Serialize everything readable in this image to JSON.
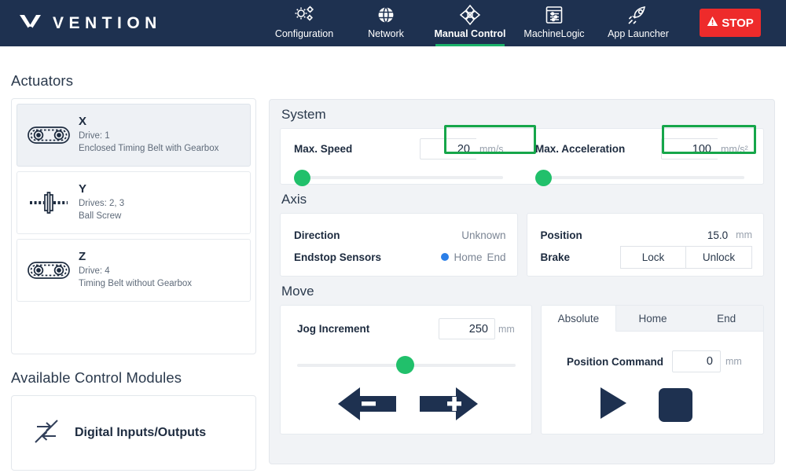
{
  "header": {
    "brand": "VENTION",
    "logo_icon": "vention-chevron-logo",
    "nav": [
      {
        "label": "Configuration",
        "icon": "gears-icon",
        "active": false
      },
      {
        "label": "Network",
        "icon": "globe-icon",
        "active": false
      },
      {
        "label": "Manual Control",
        "icon": "axes-move-icon",
        "active": true
      },
      {
        "label": "MachineLogic",
        "icon": "panel-sliders-icon",
        "active": false
      },
      {
        "label": "App Launcher",
        "icon": "rocket-icon",
        "active": false
      }
    ],
    "stop_button": {
      "label": "STOP",
      "icon": "warning-triangle-icon",
      "color": "#ee2b2b"
    }
  },
  "sidebar": {
    "actuators_title": "Actuators",
    "actuators": [
      {
        "name": "X",
        "drive": "Drive: 1",
        "type": "Enclosed Timing Belt with Gearbox",
        "icon": "timing-belt-icon",
        "selected": true
      },
      {
        "name": "Y",
        "drive": "Drives: 2, 3",
        "type": "Ball Screw",
        "icon": "ball-screw-icon",
        "selected": false
      },
      {
        "name": "Z",
        "drive": "Drive: 4",
        "type": "Timing Belt without Gearbox",
        "icon": "timing-belt-icon",
        "selected": false
      }
    ],
    "modules_title": "Available Control Modules",
    "modules": [
      {
        "label": "Digital Inputs/Outputs",
        "icon": "digital-io-icon"
      }
    ]
  },
  "system": {
    "title": "System",
    "max_speed": {
      "label": "Max. Speed",
      "value": "20",
      "unit": "mm/s",
      "highlighted": true,
      "slider_percent": 0
    },
    "max_acceleration": {
      "label": "Max. Acceleration",
      "value": "100",
      "unit": "mm/s²",
      "highlighted": true,
      "slider_percent": 0
    },
    "highlight_color": "#16a64a"
  },
  "axis": {
    "title": "Axis",
    "direction": {
      "label": "Direction",
      "value": "Unknown"
    },
    "endstop": {
      "label": "Endstop Sensors",
      "home_label": "Home",
      "end_label": "End",
      "indicator_color": "#2b7fe8"
    },
    "position": {
      "label": "Position",
      "value": "15.0",
      "unit": "mm"
    },
    "brake": {
      "label": "Brake",
      "lock_label": "Lock",
      "unlock_label": "Unlock"
    }
  },
  "move": {
    "title": "Move",
    "jog": {
      "label": "Jog Increment",
      "value": "250",
      "unit": "mm",
      "slider_percent": 50,
      "minus_icon": "arrow-left-minus-icon",
      "plus_icon": "arrow-right-plus-icon"
    },
    "tabs": [
      {
        "label": "Absolute",
        "active": true
      },
      {
        "label": "Home",
        "active": false
      },
      {
        "label": "End",
        "active": false
      }
    ],
    "position_command": {
      "label": "Position Command",
      "value": "0",
      "unit": "mm"
    },
    "controls": {
      "play_icon": "play-triangle-icon",
      "stop_icon": "stop-square-icon"
    }
  },
  "colors": {
    "header_bg": "#1e3150",
    "accent_green": "#21c06b",
    "active_underline": "#1bb26a",
    "panel_bg": "#f1f3f6"
  }
}
